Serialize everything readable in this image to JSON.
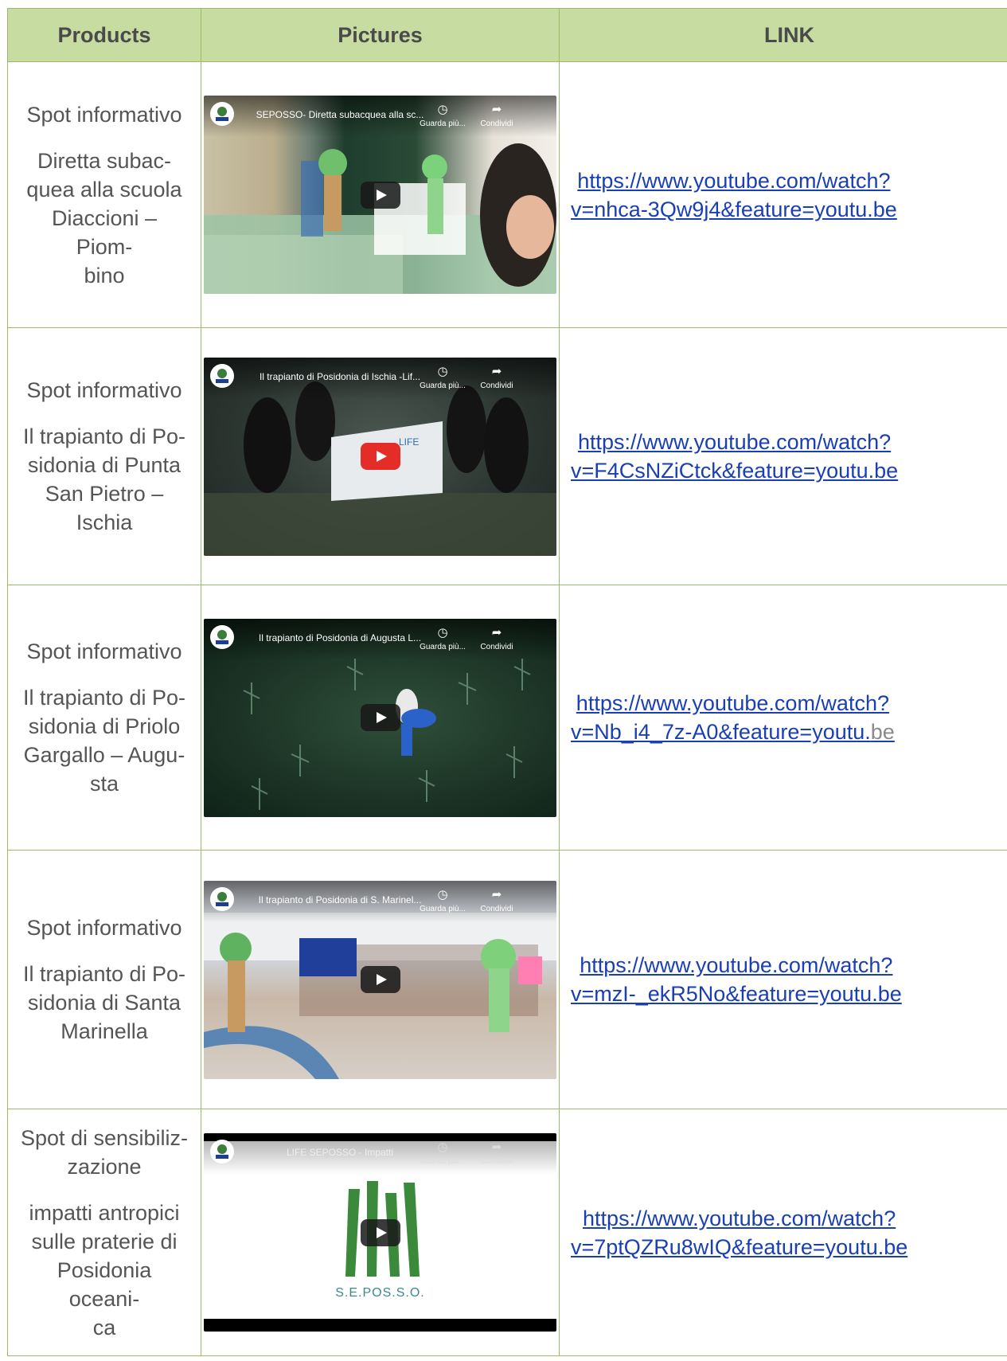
{
  "table": {
    "headers": {
      "products": "Products",
      "pictures": "Pictures",
      "link": "LINK"
    },
    "video_actions": {
      "watch_later": "Guarda più...",
      "share": "Condividi"
    },
    "rows": [
      {
        "type": "Spot informativo",
        "description": "Diretta subac-\nquea alla scuola\nDiaccioni – Piom-\nbino",
        "video_title": "SEPOSSO- Diretta subacquea alla sc...",
        "link": "https://www.youtube.com/watch?\nv=nhca-3Qw9j4&feature=youtu.be",
        "link_tail": ""
      },
      {
        "type": "Spot informativo",
        "description": "Il trapianto di Po-\nsidonia di Punta\nSan Pietro –\nIschia",
        "video_title": "Il trapianto di Posidonia di Ischia -Lif...",
        "link": "https://www.youtube.com/watch?\nv=F4CsNZiCtck&feature=youtu.be",
        "link_tail": ""
      },
      {
        "type": "Spot informativo",
        "description": "Il trapianto di Po-\nsidonia di Priolo\nGargallo – Augu-\nsta",
        "video_title": "Il trapianto di Posidonia di Augusta L...",
        "link": "https://www.youtube.com/watch?\nv=Nb_i4_7z-A0&feature=youtu.",
        "link_tail": "be"
      },
      {
        "type": "Spot informativo",
        "description": "Il trapianto di Po-\nsidonia di Santa\nMarinella",
        "video_title": "Il trapianto di Posidonia di S. Marinel...",
        "link": "https://www.youtube.com/watch?\nv=mzI-_ekR5No&feature=youtu.be",
        "link_tail": ""
      },
      {
        "type": "Spot di sensibiliz-\nzazione",
        "description": "impatti antropici\nsulle praterie di\nPosidonia oceani-\nca",
        "video_title": "LIFE SEPOSSO - Impatti",
        "link": "https://www.youtube.com/watch?\nv=7ptQZRu8wIQ&feature=youtu.be",
        "link_tail": "",
        "logo_caption": "S.E.POS.S.O."
      }
    ]
  },
  "colors": {
    "header_bg": "#c6dca0",
    "border": "#9dbb67",
    "link": "#1a3fb5",
    "youtube_red": "#e52d27"
  },
  "icons": {
    "play": "play-button-icon",
    "clock": "clock-icon",
    "share": "share-icon",
    "logo": "ispra-logo-icon"
  }
}
